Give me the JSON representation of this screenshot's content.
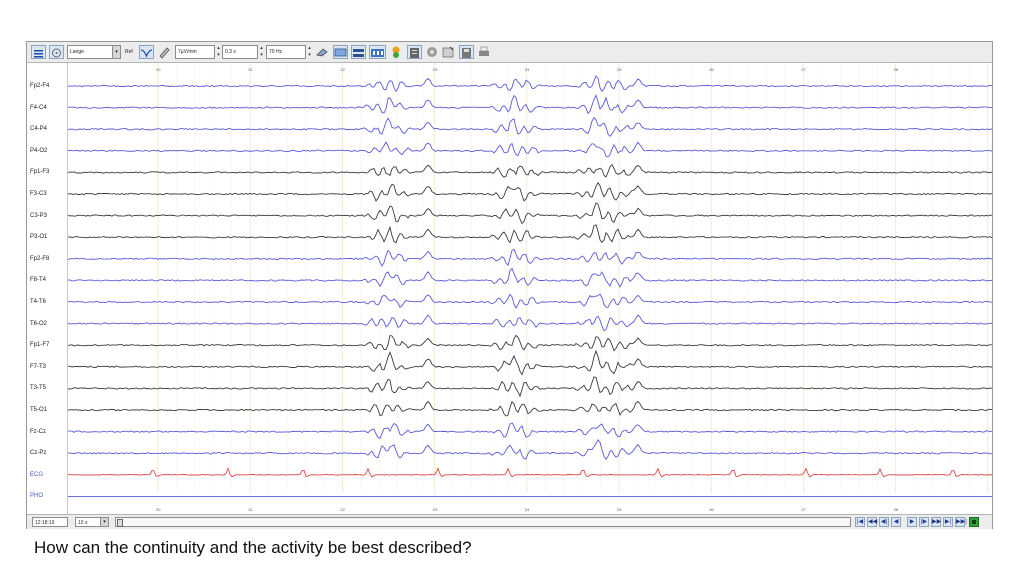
{
  "toolbar": {
    "montage_value": "Lange",
    "ref_label": "Ref",
    "sensitivity_value": "7µV/mm",
    "time_constant_value": "0.3 s",
    "hf_filter_value": "70 Hz"
  },
  "channels": [
    {
      "label": "Fp2-F4",
      "color": "#5a5ad8"
    },
    {
      "label": "F4-C4",
      "color": "#5a5ad8"
    },
    {
      "label": "C4-P4",
      "color": "#5a5ad8"
    },
    {
      "label": "P4-O2",
      "color": "#5a5ad8"
    },
    {
      "label": "Fp1-F3",
      "color": "#3a3a3a"
    },
    {
      "label": "F3-C3",
      "color": "#3a3a3a"
    },
    {
      "label": "C3-P3",
      "color": "#3a3a3a"
    },
    {
      "label": "P3-O1",
      "color": "#3a3a3a"
    },
    {
      "label": "Fp2-F8",
      "color": "#5a5ad8"
    },
    {
      "label": "F8-T4",
      "color": "#5a5ad8"
    },
    {
      "label": "T4-T6",
      "color": "#5a5ad8"
    },
    {
      "label": "T6-O2",
      "color": "#5a5ad8"
    },
    {
      "label": "Fp1-F7",
      "color": "#3a3a3a"
    },
    {
      "label": "F7-T3",
      "color": "#3a3a3a"
    },
    {
      "label": "T3-T5",
      "color": "#3a3a3a"
    },
    {
      "label": "T5-O1",
      "color": "#3a3a3a"
    },
    {
      "label": "Fz-Cz",
      "color": "#5a5ad8"
    },
    {
      "label": "Cz-Pz",
      "color": "#5a5ad8"
    },
    {
      "label": "ECG",
      "color": "#d84848"
    },
    {
      "label": "PHO",
      "color": "#5a5ad8"
    }
  ],
  "time_ticks": [
    "20",
    "21",
    "22",
    "23",
    "24",
    "25",
    "26",
    "27",
    "28"
  ],
  "bottombar": {
    "clock_value": "12:18:19",
    "epoch_value": "10 s"
  },
  "question": "How can the continuity and the activity be best described?"
}
